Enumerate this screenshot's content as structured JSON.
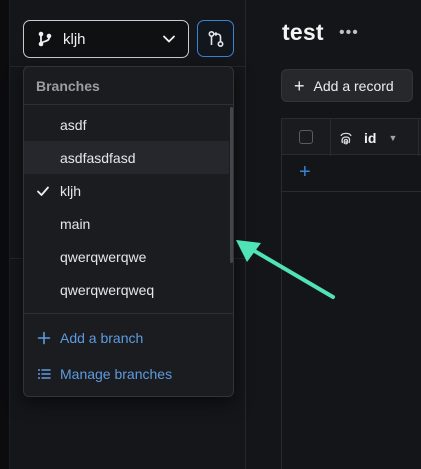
{
  "sidebar": {
    "branch_selector": {
      "current": "kljh",
      "icon": "git-branch-icon",
      "chevron": "chevron-down-icon"
    },
    "compare_button": {
      "icon": "git-compare-icon"
    }
  },
  "main": {
    "title": "test",
    "title_menu": "•••",
    "add_record_label": "Add a record",
    "table": {
      "columns": [
        {
          "label": "id",
          "icon": "fingerprint-icon"
        }
      ],
      "add_row_label": "+"
    }
  },
  "dropdown": {
    "header": "Branches",
    "branches": [
      {
        "name": "asdf",
        "selected": false,
        "hovered": false
      },
      {
        "name": "asdfasdfasd",
        "selected": false,
        "hovered": true
      },
      {
        "name": "kljh",
        "selected": true,
        "hovered": false
      },
      {
        "name": "main",
        "selected": false,
        "hovered": false
      },
      {
        "name": "qwerqwerqwe",
        "selected": false,
        "hovered": false
      },
      {
        "name": "qwerqwerqweq",
        "selected": false,
        "hovered": false
      }
    ],
    "actions": {
      "add_branch": "Add a branch",
      "manage_branches": "Manage branches"
    }
  },
  "colors": {
    "accent": "#3b82d4",
    "link": "#5d9be0",
    "annotation_arrow": "#4fe3b5"
  }
}
